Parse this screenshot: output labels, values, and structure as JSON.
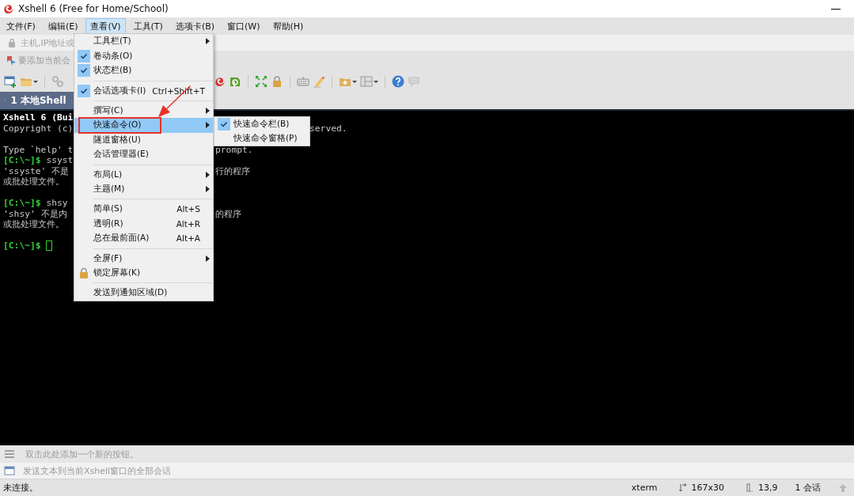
{
  "window": {
    "title": "Xshell 6 (Free for Home/School)"
  },
  "menu_bar": [
    {
      "label": "文件(F)",
      "selected": false
    },
    {
      "label": "编辑(E)",
      "selected": false
    },
    {
      "label": "查看(V)",
      "selected": true
    },
    {
      "label": "工具(T)",
      "selected": false
    },
    {
      "label": "选项卡(B)",
      "selected": false
    },
    {
      "label": "窗口(W)",
      "selected": false
    },
    {
      "label": "帮助(H)",
      "selected": false
    }
  ],
  "address_bar": {
    "placeholder": "主机,IP地址或"
  },
  "links_bar": {
    "text": "要添加当前会"
  },
  "tabs": [
    {
      "label": "1 本地Shell",
      "selected": true
    }
  ],
  "terminal": {
    "lines": [
      {
        "kind": "text",
        "bold": true,
        "left": "Xshell 6 (Bui"
      },
      {
        "kind": "text",
        "bold": false,
        "left": "Copyright (c)",
        "right": "served."
      },
      {
        "kind": "blank"
      },
      {
        "kind": "text",
        "bold": false,
        "left": "Type `help' t",
        "mid": "prompt."
      },
      {
        "kind": "prompt",
        "prompt": "[C:\\~]$",
        "command": "ssyst",
        "cursor": false
      },
      {
        "kind": "text",
        "bold": false,
        "left": "'ssyste' 不是",
        "mid": "行的程序"
      },
      {
        "kind": "text",
        "bold": false,
        "left": "或批处理文件。"
      },
      {
        "kind": "blank"
      },
      {
        "kind": "prompt",
        "prompt": "[C:\\~]$",
        "command": "shsy",
        "cursor": false
      },
      {
        "kind": "text",
        "bold": false,
        "left": "'shsy' 不是内",
        "mid": "的程序"
      },
      {
        "kind": "text",
        "bold": false,
        "left": "或批处理文件。"
      },
      {
        "kind": "blank"
      },
      {
        "kind": "prompt",
        "prompt": "[C:\\~]$",
        "cursor": true
      }
    ]
  },
  "view_menu": [
    {
      "kind": "item",
      "label": "工具栏(T)",
      "checked": false,
      "submenu": true,
      "selected": false
    },
    {
      "kind": "item",
      "label": "卷动条(O)",
      "checked": true,
      "submenu": false,
      "selected": false
    },
    {
      "kind": "item",
      "label": "状态栏(B)",
      "checked": true,
      "submenu": false,
      "selected": false
    },
    {
      "kind": "separator"
    },
    {
      "kind": "item",
      "label": "会话选项卡(I)",
      "checked": true,
      "shortcut": "Ctrl+Shift+T",
      "submenu": false,
      "selected": false
    },
    {
      "kind": "separator"
    },
    {
      "kind": "item",
      "label": "撰写(C)",
      "checked": false,
      "submenu": true,
      "selected": false
    },
    {
      "kind": "item",
      "label": "快速命令(O)",
      "checked": false,
      "submenu": true,
      "selected": true,
      "annotated": true,
      "children": [
        {
          "label": "快速命令栏(B)",
          "checked": true
        },
        {
          "label": "快速命令窗格(P)",
          "checked": false
        }
      ]
    },
    {
      "kind": "item",
      "label": "隧道窗格(U)",
      "checked": false,
      "submenu": false,
      "selected": false
    },
    {
      "kind": "item",
      "label": "会话管理器(E)",
      "checked": false,
      "submenu": false,
      "selected": false
    },
    {
      "kind": "separator"
    },
    {
      "kind": "item",
      "label": "布局(L)",
      "checked": false,
      "submenu": true,
      "selected": false
    },
    {
      "kind": "item",
      "label": "主题(M)",
      "checked": false,
      "submenu": true,
      "selected": false
    },
    {
      "kind": "separator"
    },
    {
      "kind": "item",
      "label": "简单(S)",
      "checked": false,
      "shortcut": "Alt+S",
      "submenu": false,
      "selected": false
    },
    {
      "kind": "item",
      "label": "透明(R)",
      "checked": false,
      "shortcut": "Alt+R",
      "submenu": false,
      "selected": false
    },
    {
      "kind": "item",
      "label": "总在最前面(A)",
      "checked": false,
      "shortcut": "Alt+A",
      "submenu": false,
      "selected": false
    },
    {
      "kind": "separator"
    },
    {
      "kind": "item",
      "label": "全屏(F)",
      "checked": false,
      "submenu": true,
      "selected": false
    },
    {
      "kind": "item",
      "label": "锁定屏幕(K)",
      "checked": false,
      "submenu": false,
      "selected": false,
      "lock_icon": true
    },
    {
      "kind": "separator"
    },
    {
      "kind": "item",
      "label": "发送到通知区域(D)",
      "checked": false,
      "submenu": false,
      "selected": false
    }
  ],
  "quick_command_bar": {
    "text": "双击此处添加一个新的按钮。"
  },
  "compose_bar": {
    "text": "发送文本到当前Xshell窗口的全部会话"
  },
  "status_bar": {
    "message": "未连接。",
    "terminal": "xterm",
    "size": "167x30",
    "cursor": "13,9",
    "sessions": "1 会话"
  }
}
